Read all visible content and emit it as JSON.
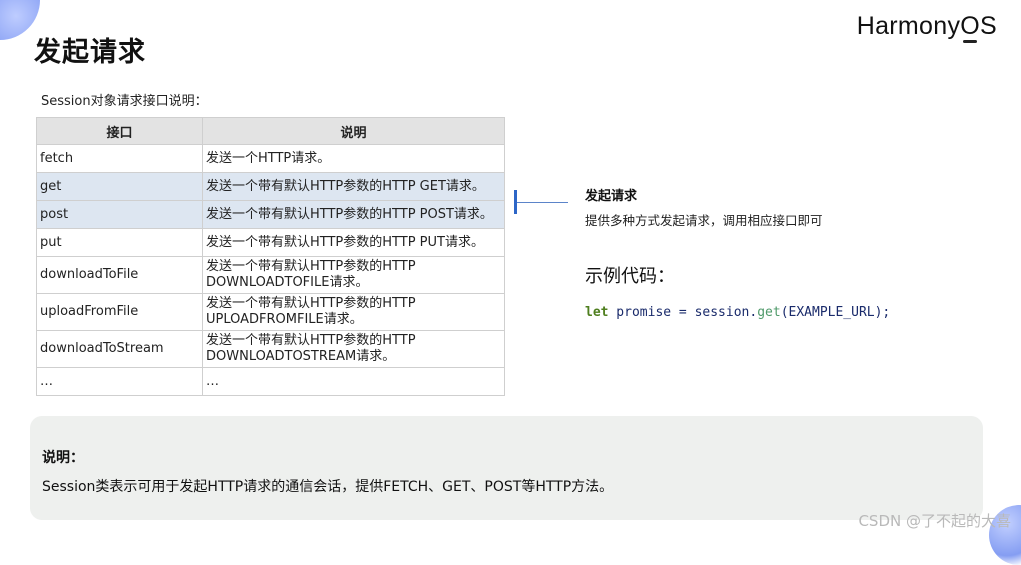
{
  "slide": {
    "title": "发起请求",
    "brand": {
      "part1": "Harmony",
      "o": "O",
      "s": "S"
    },
    "subtitle": "Session对象请求接口说明："
  },
  "table": {
    "headers": [
      "接口",
      "说明"
    ],
    "rows": [
      {
        "api": "fetch",
        "desc": "发送一个HTTP请求。"
      },
      {
        "api": "get",
        "desc": "发送一个带有默认HTTP参数的HTTP GET请求。"
      },
      {
        "api": "post",
        "desc": "发送一个带有默认HTTP参数的HTTP POST请求。"
      },
      {
        "api": "put",
        "desc": "发送一个带有默认HTTP参数的HTTP PUT请求。"
      },
      {
        "api": "downloadToFile",
        "desc_line1": "发送一个带有默认HTTP参数的HTTP",
        "desc_line2": "DOWNLOADTOFILE请求。"
      },
      {
        "api": "uploadFromFile",
        "desc_line1": "发送一个带有默认HTTP参数的HTTP",
        "desc_line2": "UPLOADFROMFILE请求。"
      },
      {
        "api": "downloadToStream",
        "desc_line1": "发送一个带有默认HTTP参数的HTTP",
        "desc_line2": "DOWNLOADTOSTREAM请求。"
      },
      {
        "api": "…",
        "desc": "…"
      }
    ]
  },
  "callout": {
    "title": "发起请求",
    "desc": "提供多种方式发起请求，调用相应接口即可"
  },
  "example": {
    "title": "示例代码：",
    "code": {
      "keyword": "let",
      "pre": " promise = session.",
      "method": "get",
      "post": "(EXAMPLE_URL);"
    }
  },
  "note": {
    "title": "说明：",
    "text": "Session类表示可用于发起HTTP请求的通信会话，提供FETCH、GET、POST等HTTP方法。"
  },
  "watermark": "CSDN @了不起的大喜",
  "colors": {
    "highlight_row": "#dde6f1",
    "accent": "#2d66c7",
    "note_bg": "#eef0ee"
  }
}
